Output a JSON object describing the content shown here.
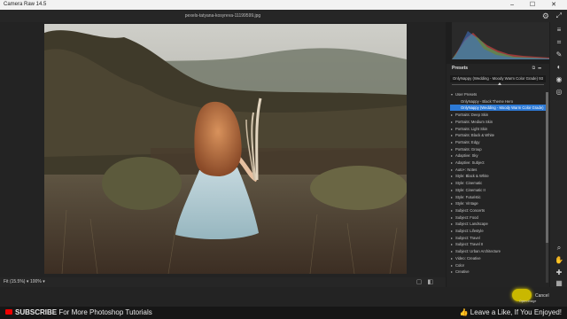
{
  "app": {
    "title": "Camera Raw 14.5",
    "window_controls": "– ☐ ✕"
  },
  "document": {
    "filename": "pexels-tatyana-kosyreva-11199599.jpg"
  },
  "toolbar_top": {
    "settings_icon": "gear-icon",
    "fullscreen_icon": "expand-icon"
  },
  "view": {
    "zoom_fit_label": "Fit (15.5%)",
    "zoom_100_label": "100%",
    "dropdown_caret": "▾"
  },
  "presets_panel": {
    "title": "Presets",
    "current_preset": "OnlyNappy (Wedding - Moody Warm Color Grade)",
    "amount": "93",
    "items": [
      {
        "label": "User Presets",
        "type": "group",
        "open": true
      },
      {
        "label": "OnlyNappy - Black Theme Hero",
        "type": "child"
      },
      {
        "label": "OnlyNappy (Wedding - Moody Warm Color Grade)",
        "type": "child",
        "selected": true
      },
      {
        "label": "Portraits: Deep Skin",
        "type": "group"
      },
      {
        "label": "Portraits: Medium Skin",
        "type": "group"
      },
      {
        "label": "Portraits: Light Skin",
        "type": "group"
      },
      {
        "label": "Portraits: Black & White",
        "type": "group"
      },
      {
        "label": "Portraits: Edgy",
        "type": "group"
      },
      {
        "label": "Portraits: Group",
        "type": "group"
      },
      {
        "label": "Adaptive: Sky",
        "type": "group"
      },
      {
        "label": "Adaptive: Subject",
        "type": "group"
      },
      {
        "label": "Auto+: Notes",
        "type": "group"
      },
      {
        "label": "Style: Black & White",
        "type": "group"
      },
      {
        "label": "Style: Cinematic",
        "type": "group"
      },
      {
        "label": "Style: Cinematic II",
        "type": "group"
      },
      {
        "label": "Style: Futuristic",
        "type": "group"
      },
      {
        "label": "Style: Vintage",
        "type": "group"
      },
      {
        "label": "Subject: Concerts",
        "type": "group"
      },
      {
        "label": "Subject: Food",
        "type": "group"
      },
      {
        "label": "Subject: Landscape",
        "type": "group"
      },
      {
        "label": "Subject: Lifestyle",
        "type": "group"
      },
      {
        "label": "Subject: Travel",
        "type": "group"
      },
      {
        "label": "Subject: Travel II",
        "type": "group"
      },
      {
        "label": "Subject: Urban Architecture",
        "type": "group"
      },
      {
        "label": "Video: Creative",
        "type": "group"
      },
      {
        "label": "Color",
        "type": "group"
      },
      {
        "label": "Creative",
        "type": "group"
      }
    ]
  },
  "footer": {
    "cancel_label": "Cancel",
    "open_caption": "Open Image"
  },
  "banner": {
    "left_text_bold": "SUBSCRIBE",
    "left_text": " For More Photoshop Tutorials",
    "right_text": "Leave a Like, If You Enjoyed!"
  },
  "colors": {
    "selection": "#2d7ad6",
    "highlight_button": "#c9b800",
    "panel_bg": "#242424"
  }
}
